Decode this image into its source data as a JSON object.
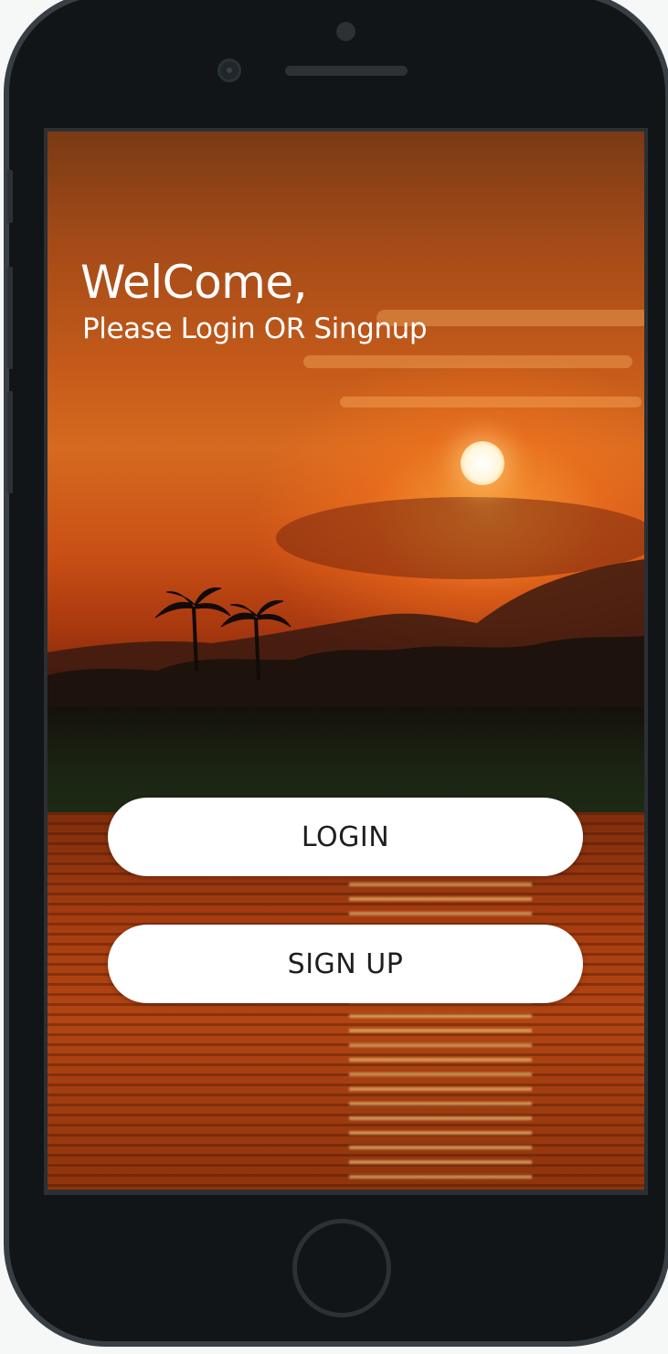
{
  "welcome": {
    "title": "WelCome,",
    "subtitle": "Please Login OR Singnup"
  },
  "actions": {
    "login_label": "LOGIN",
    "signup_label": "SIGN UP"
  },
  "colors": {
    "button_bg": "#ffffff",
    "button_text": "#1e1e1e",
    "device_body": "#111517",
    "device_bezel": "#383f44"
  },
  "background": {
    "scene": "sunset-over-river-photo"
  }
}
